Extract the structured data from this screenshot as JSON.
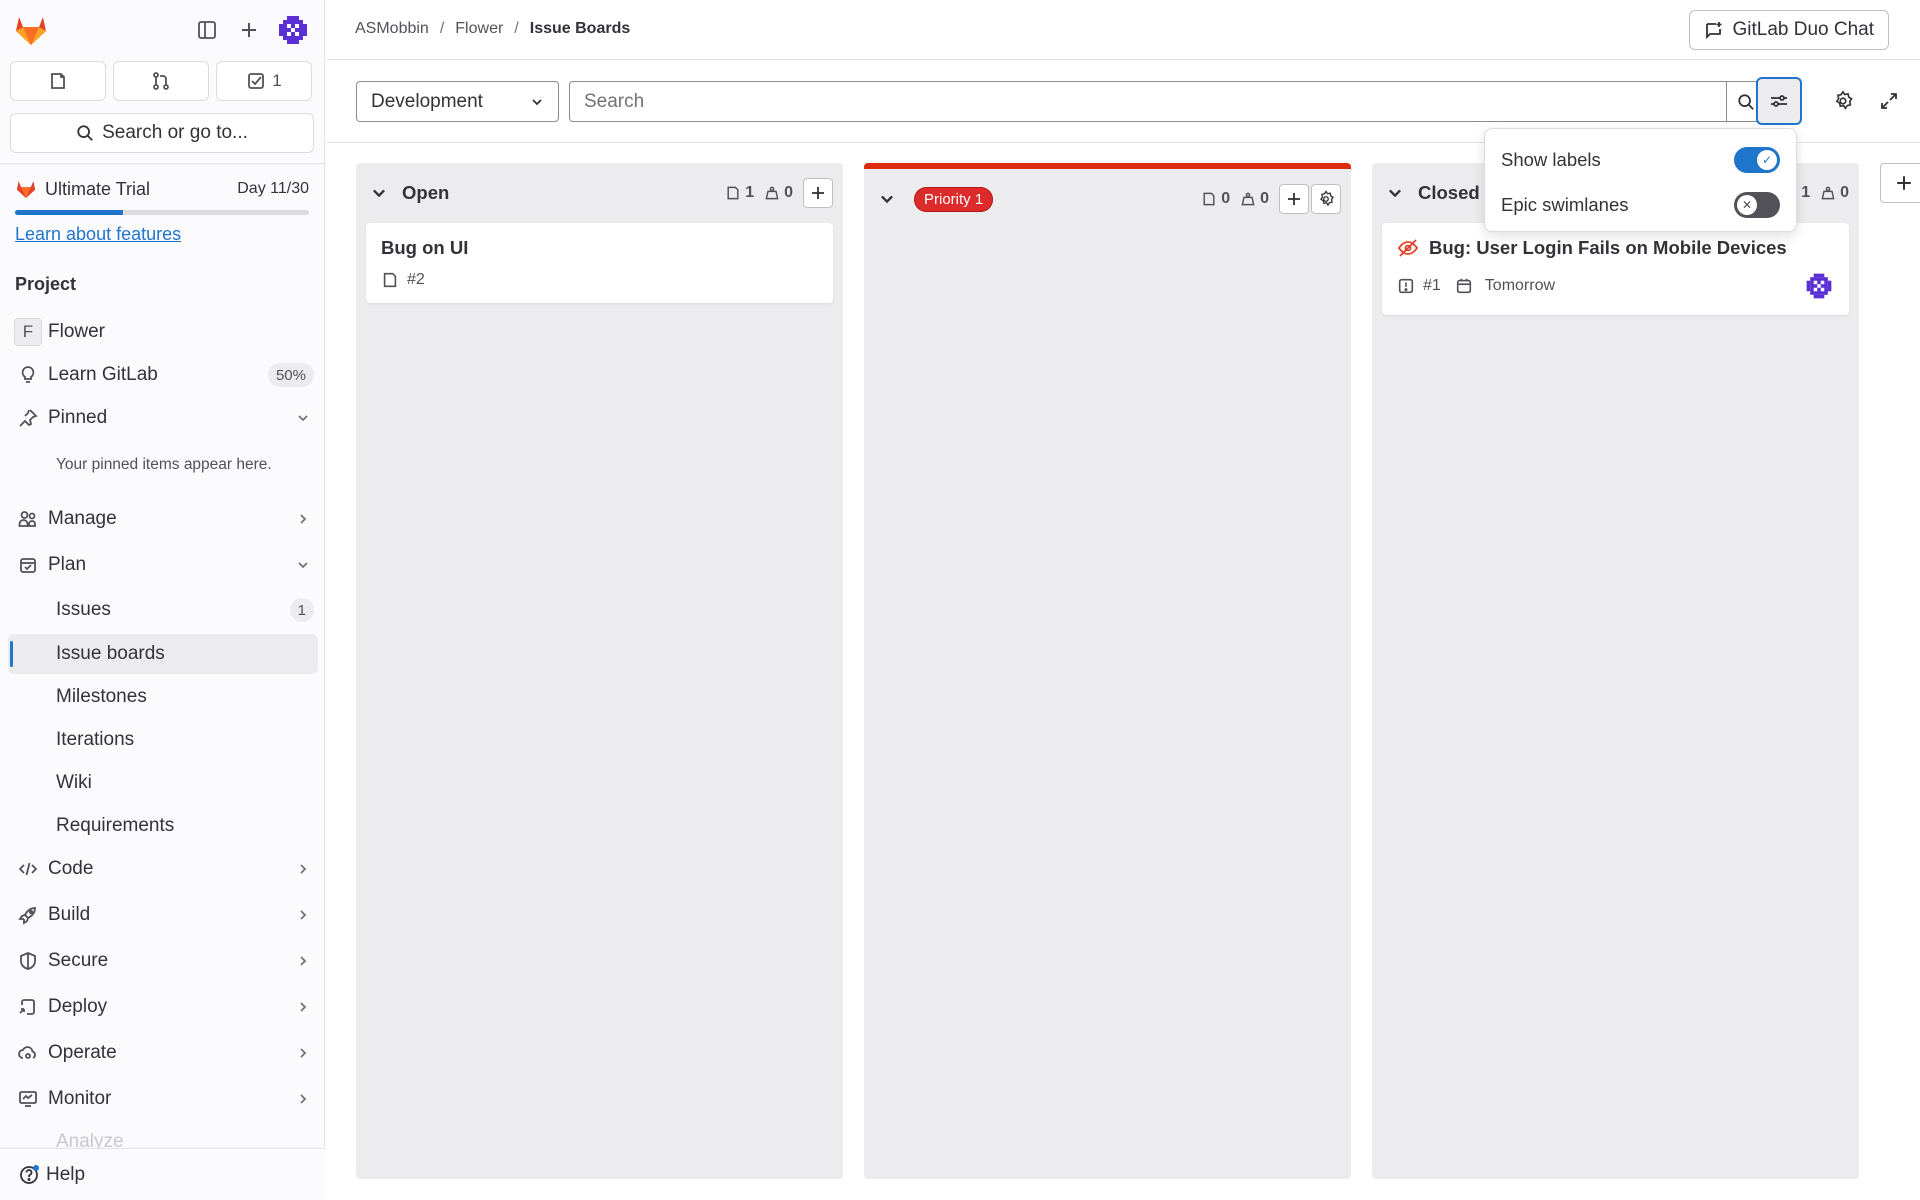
{
  "sidebar": {
    "merge_requests_tab_count": "",
    "todos_count": "1",
    "search_label": "Search or go to...",
    "trial": {
      "name": "Ultimate Trial",
      "day": "Day 11/30",
      "progress": 0.367,
      "link": "Learn about features"
    },
    "section_title": "Project",
    "project": {
      "letter": "F",
      "name": "Flower"
    },
    "learn": {
      "label": "Learn GitLab",
      "badge": "50%"
    },
    "pinned": {
      "label": "Pinned",
      "note": "Your pinned items appear here."
    },
    "manage": "Manage",
    "plan": {
      "label": "Plan",
      "items": [
        {
          "label": "Issues",
          "badge": "1"
        },
        {
          "label": "Issue boards"
        },
        {
          "label": "Milestones"
        },
        {
          "label": "Iterations"
        },
        {
          "label": "Wiki"
        },
        {
          "label": "Requirements"
        }
      ]
    },
    "groups": [
      "Code",
      "Build",
      "Secure",
      "Deploy",
      "Operate",
      "Monitor"
    ],
    "faded_item": "Analyze",
    "help": "Help"
  },
  "breadcrumb": [
    "ASMobbin",
    "Flower",
    "Issue Boards"
  ],
  "duo_chat": "GitLab Duo Chat",
  "filter": {
    "board": "Development",
    "search_placeholder": "Search"
  },
  "lists": [
    {
      "title": "Open",
      "issue_count": "1",
      "weight": "0",
      "cards": [
        {
          "title": "Bug on UI",
          "ref": "#2"
        }
      ]
    },
    {
      "label": "Priority 1",
      "issue_count": "0",
      "weight": "0",
      "cards": []
    },
    {
      "title": "Closed",
      "issue_count": "1",
      "weight": "0",
      "cards": [
        {
          "title": "Bug: User Login Fails on Mobile Devices",
          "ref": "#1",
          "due": "Tomorrow"
        }
      ]
    }
  ],
  "view_options": {
    "show_labels": {
      "label": "Show labels",
      "on": true
    },
    "epic_swimlanes": {
      "label": "Epic swimlanes",
      "on": false
    }
  },
  "colors": {
    "accent": "#1f75cb",
    "label_red": "#dd2b2b",
    "tanuki_orange": "#e24329"
  }
}
